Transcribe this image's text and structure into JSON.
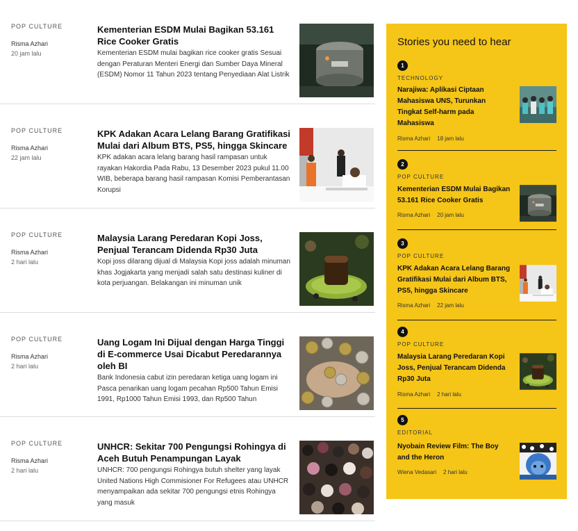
{
  "articles": [
    {
      "category": "POP CULTURE",
      "author": "Risma Azhari",
      "time": "20 jam lalu",
      "title": "Kementerian ESDM Mulai Bagikan 53.161 Rice Cooker Gratis",
      "excerpt": "Kementerian ESDM mulai bagikan rice cooker gratis Sesuai dengan Peraturan Menteri Energi dan Sumber Daya Mineral (ESDM) Nomor 11 Tahun 2023 tentang Penyediaan Alat Listrik",
      "image": "rice-cooker-photo"
    },
    {
      "category": "POP CULTURE",
      "author": "Risma Azhari",
      "time": "22 jam lalu",
      "title": "KPK Adakan Acara Lelang Barang Gratifikasi Mulai dari Album BTS, PS5, hingga Skincare",
      "excerpt": "KPK adakan acara lelang barang hasil rampasan untuk rayakan Hakordia Pada Rabu, 13 Desember 2023 pukul  11.00 WIB, beberapa barang hasil rampasan Komisi Pemberantasan Korupsi",
      "image": "kpk-press-photo"
    },
    {
      "category": "POP CULTURE",
      "author": "Risma Azhari",
      "time": "2 hari lalu",
      "title": "Malaysia Larang Peredaran Kopi Joss, Penjual Terancam Didenda Rp30 Juta",
      "excerpt": "Kopi joss dilarang dijual di Malaysia Kopi joss adalah minuman khas Jogjakarta yang menjadi salah satu destinasi kuliner di kota perjuangan. Belakangan ini minuman unik",
      "image": "kopi-joss-photo"
    },
    {
      "category": "POP CULTURE",
      "author": "Risma Azhari",
      "time": "2 hari lalu",
      "title": "Uang Logam Ini Dijual dengan Harga Tinggi di E-commerce Usai Dicabut Peredarannya oleh BI",
      "excerpt": "Bank Indonesia cabut izin peredaran ketiga uang logam ini Pasca penarikan uang logam pecahan Rp500 Tahun Emisi 1991, Rp1000 Tahun Emisi 1993, dan Rp500 Tahun",
      "image": "coins-photo"
    },
    {
      "category": "POP CULTURE",
      "author": "Risma Azhari",
      "time": "2 hari lalu",
      "title": "UNHCR: Sekitar 700 Pengungsi Rohingya di Aceh Butuh Penampungan Layak",
      "excerpt": "UNHCR: 700 pengungsi Rohingya butuh shelter yang layak United Nations High Commisioner For Refugees atau UNHCR menyampaikan ada sekitar 700 pengungsi etnis Rohingya yang masuk",
      "image": "refugees-photo"
    }
  ],
  "sidebar": {
    "title": "Stories you need to hear",
    "background": "#f5c518",
    "stories": [
      {
        "number": "1",
        "category": "TECHNOLOGY",
        "title": "Narajiwa: Aplikasi Ciptaan Mahasiswa UNS, Turunkan Tingkat Self-harm pada Mahasiswa",
        "author": "Risma Azhari",
        "time": "18 jam lalu",
        "image": "students-photo"
      },
      {
        "number": "2",
        "category": "POP CULTURE",
        "title": "Kementerian ESDM Mulai Bagikan 53.161 Rice Cooker Gratis",
        "author": "Risma Azhari",
        "time": "20 jam lalu",
        "image": "rice-cooker-photo"
      },
      {
        "number": "3",
        "category": "POP CULTURE",
        "title": "KPK Adakan Acara Lelang Barang Gratifikasi Mulai dari Album BTS, PS5, hingga Skincare",
        "author": "Risma Azhari",
        "time": "22 jam lalu",
        "image": "kpk-press-photo"
      },
      {
        "number": "4",
        "category": "POP CULTURE",
        "title": "Malaysia Larang Peredaran Kopi Joss, Penjual Terancam Didenda Rp30 Juta",
        "author": "Risma Azhari",
        "time": "2 hari lalu",
        "image": "kopi-joss-photo"
      },
      {
        "number": "5",
        "category": "EDITORIAL",
        "title": "Nyobain Review Film: The Boy and the Heron",
        "author": "Wiena Vedasari",
        "time": "2 hari lalu",
        "image": "anime-still"
      }
    ]
  }
}
